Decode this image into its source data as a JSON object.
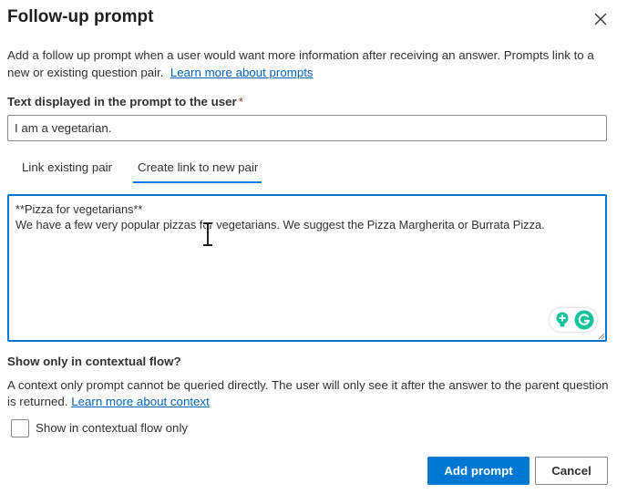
{
  "dialog": {
    "title": "Follow-up prompt",
    "close_icon": "close-icon",
    "description": "Add a follow up prompt when a user would want more information after receiving an answer. Prompts link to a new or existing question pair.",
    "learn_more_prompts": "Learn more about prompts"
  },
  "prompt_text": {
    "label": "Text displayed in the prompt to the user",
    "required_marker": "*",
    "value": "I am a vegetarian."
  },
  "tabs": [
    {
      "label": "Link existing pair",
      "selected": false
    },
    {
      "label": "Create link to new pair",
      "selected": true
    }
  ],
  "answer_editor": {
    "line1": "**Pizza for vegetarians**",
    "line2": "We have a few very popular pizzas for vegetarians. We suggest the Pizza Margherita or Burrata Pizza.",
    "grammarly_icons": [
      "lightbulb-plus-icon",
      "grammarly-g-icon"
    ]
  },
  "contextual": {
    "title": "Show only in contextual flow?",
    "description": "A context only prompt cannot be queried directly. The user will only see it after the answer to the parent question is returned.",
    "learn_more_context": "Learn more about context",
    "checkbox_label": "Show in contextual flow only",
    "checked": false
  },
  "buttons": {
    "add_prompt": "Add prompt",
    "cancel": "Cancel"
  },
  "colors": {
    "accent": "#0078d4",
    "link": "#0064bf",
    "required": "#a4262c",
    "grammarly_green": "#15c39a"
  }
}
